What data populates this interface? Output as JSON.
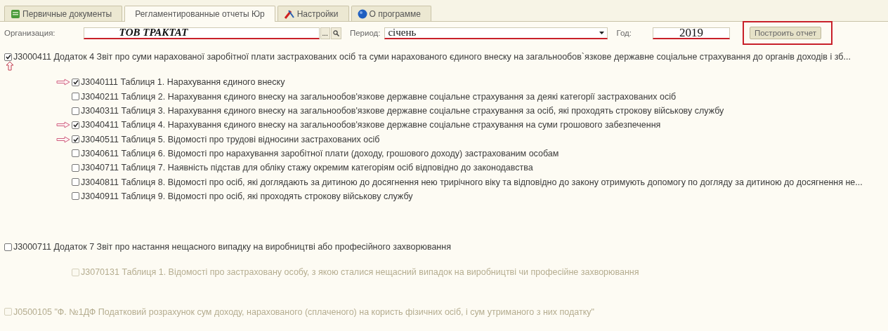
{
  "tabs": [
    {
      "label": "Первичные документы",
      "selected": false
    },
    {
      "label": "Регламентированные отчеты Юр",
      "selected": true
    },
    {
      "label": "Настройки",
      "selected": false
    },
    {
      "label": "О программе",
      "selected": false
    }
  ],
  "form": {
    "organization": {
      "label": "Организация:",
      "value": "ТОВ ТРАКТАТ",
      "underlined": true,
      "select_button": "..."
    },
    "period": {
      "label": "Период:",
      "value": "січень",
      "underlined": true
    },
    "year": {
      "label": "Год:",
      "value": "2019",
      "underlined": true
    },
    "build_button": {
      "label": "Построить отчет",
      "framed": true
    }
  },
  "reports": [
    {
      "code": "J3000411",
      "text": "Додаток 4 Звіт про суми нарахованої заробітної плати застрахованих осіб та суми нарахованого єдиного внеску на загальнообов`язкове державне соціальне страхування до органів доходів і зб...",
      "checked": true,
      "disabled": false,
      "up_marker": true,
      "children": [
        {
          "code": "J3040111",
          "text": "Таблиця 1. Нарахування єдиного внеску",
          "checked": true,
          "disabled": false,
          "marked": true
        },
        {
          "code": "J3040211",
          "text": "Таблиця 2. Нарахування єдиного внеску на загальнообов'язкове державне соціальне страхування за деякі категорії застрахованих осіб",
          "checked": false,
          "disabled": false,
          "marked": false
        },
        {
          "code": "J3040311",
          "text": "Таблиця 3. Нарахування єдиного внеску на загальнообов'язкове державне соціальне страхування за осіб, які проходять строкову військову службу",
          "checked": false,
          "disabled": false,
          "marked": false
        },
        {
          "code": "J3040411",
          "text": "Таблиця 4. Нарахування єдиного внеску на загальнообов'язкове державне соціальне страхування на суми грошового забезпечення",
          "checked": true,
          "disabled": false,
          "marked": true
        },
        {
          "code": "J3040511",
          "text": "Таблиця 5. Відомості про трудові відносини застрахованих осіб",
          "checked": true,
          "disabled": false,
          "marked": true
        },
        {
          "code": "J3040611",
          "text": "Таблиця 6. Відомості про нарахування заробітної плати (доходу, грошового доходу) застрахованим особам",
          "checked": false,
          "disabled": false,
          "marked": false
        },
        {
          "code": "J3040711",
          "text": "Таблиця 7. Наявність підстав для обліку стажу окремим категоріям осіб відповідно до законодавства",
          "checked": false,
          "disabled": false,
          "marked": false
        },
        {
          "code": "J3040811",
          "text": "Таблиця 8. Відомості про осіб, які доглядають за дитиною до досягнення нею трирічного віку та відповідно до закону отримують допомогу по догляду за дитиною до досягнення не...",
          "checked": false,
          "disabled": false,
          "marked": false
        },
        {
          "code": "J3040911",
          "text": "Таблиця 9. Відомості про осіб, які проходять строкову військову службу",
          "checked": false,
          "disabled": false,
          "marked": false
        }
      ]
    },
    {
      "code": "J3000711",
      "text": "Додаток 7 Звіт про настання нещасного випадку на виробництві або професійного захворювання",
      "checked": false,
      "disabled": false,
      "up_marker": false,
      "children": [
        {
          "code": "J3070131",
          "text": "Таблиця 1. Відомості про застраховану особу, з якою сталися нещасний випадок на виробництві чи професійне захворювання",
          "checked": false,
          "disabled": true,
          "marked": false
        }
      ]
    },
    {
      "code": "J0500105",
      "text": "\"Ф. №1ДФ Податковий розрахунок сум доходу, нарахованого (сплаченого) на користь фізичних осіб, і сум утриманого з них податку\"",
      "checked": false,
      "disabled": true,
      "up_marker": false
    }
  ]
}
